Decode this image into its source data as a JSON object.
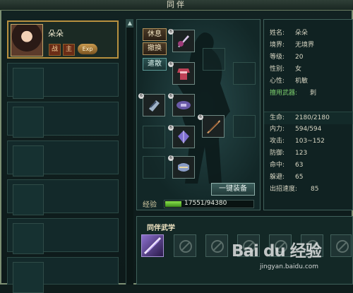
{
  "window": {
    "title": "同伴"
  },
  "companion": {
    "name": "朵朵",
    "tags": [
      "战",
      "主"
    ],
    "exp_button": "Exp"
  },
  "actions": {
    "rest": "休息",
    "withdraw": "撤换",
    "dismiss": "遣散"
  },
  "equipment": {
    "one_click_equip": "一键装备",
    "exp_label": "经验",
    "exp_text": "17551/94380",
    "exp_fraction": 0.186,
    "item_level": "6"
  },
  "stats": [
    {
      "label": "姓名:",
      "value": "朵朵"
    },
    {
      "label": "境界:",
      "value": "无境界"
    },
    {
      "label": "等级:",
      "value": "20"
    },
    {
      "label": "性别:",
      "value": "女"
    },
    {
      "label": "心性:",
      "value": "机敏"
    },
    {
      "label": "擅用武器:",
      "value": "刺"
    },
    {
      "label": "生命:",
      "value": "2180/2180"
    },
    {
      "label": "内力:",
      "value": "594/594"
    },
    {
      "label": "攻击:",
      "value": "103~152"
    },
    {
      "label": "防御:",
      "value": "123"
    },
    {
      "label": "命中:",
      "value": "63"
    },
    {
      "label": "躲避:",
      "value": "65"
    },
    {
      "label": "出招速度:",
      "value": "85"
    }
  ],
  "skills": {
    "title": "同伴武学"
  },
  "watermark": {
    "logo": "Bai du 经验",
    "url": "jingyan.baidu.com"
  },
  "colors": {
    "gold_border": "#b7903f",
    "exp_green": "#6bcf3a",
    "stat_highlight": "#7dd06e"
  },
  "icons": [
    "scroll-up-icon",
    "weapon-dagger-icon",
    "armor-icon",
    "bracer-icon",
    "sash-icon",
    "blade-icon",
    "gem-icon",
    "boots-icon",
    "skill-purple-icon",
    "locked-skill-icon"
  ]
}
